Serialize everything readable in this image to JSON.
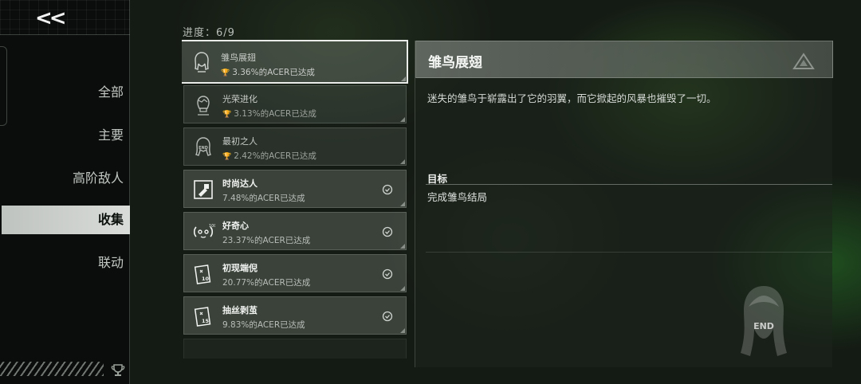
{
  "navigation": {
    "back_label": "<<",
    "items": [
      {
        "label": "全部"
      },
      {
        "label": "主要"
      },
      {
        "label": "高阶敌人"
      },
      {
        "label": "收集",
        "active": true
      },
      {
        "label": "联动"
      }
    ]
  },
  "progress": {
    "label": "进度：6/9"
  },
  "achievements": [
    {
      "title": "雏鸟展翅",
      "rate": "3.36%的ACER已达成",
      "icon": "girl-silhouette-icon",
      "selected": true,
      "unlocked": false
    },
    {
      "title": "光荣进化",
      "rate": "3.13%的ACER已达成",
      "icon": "boy-silhouette-icon",
      "unlocked": false
    },
    {
      "title": "最初之人",
      "rate": "2.42%的ACER已达成",
      "icon": "end-silhouette-icon",
      "unlocked": false
    },
    {
      "title": "时尚达人",
      "rate": "7.48%的ACER已达成",
      "icon": "fashion-card-icon",
      "unlocked": true
    },
    {
      "title": "好奇心",
      "rate": "23.37%的ACER已达成",
      "icon": "curiosity-icon",
      "unlocked": true
    },
    {
      "title": "初现端倪",
      "rate": "20.77%的ACER已达成",
      "icon": "card-10-icon",
      "unlocked": true
    },
    {
      "title": "抽丝剥茧",
      "rate": "9.83%的ACER已达成",
      "icon": "card-15-icon",
      "unlocked": true
    }
  ],
  "detail": {
    "title": "雏鸟展翅",
    "description": "迷失的雏鸟于崭露出了它的羽翼，而它掀起的风暴也摧毁了一切。",
    "goal_label": "目标",
    "goal_text": "完成雏鸟结局",
    "emblem_text": "END"
  },
  "colors": {
    "accent_green": "#3e7a30",
    "active_tab_bg": "#d0d3d0",
    "selected_border": "#e9ece9"
  }
}
